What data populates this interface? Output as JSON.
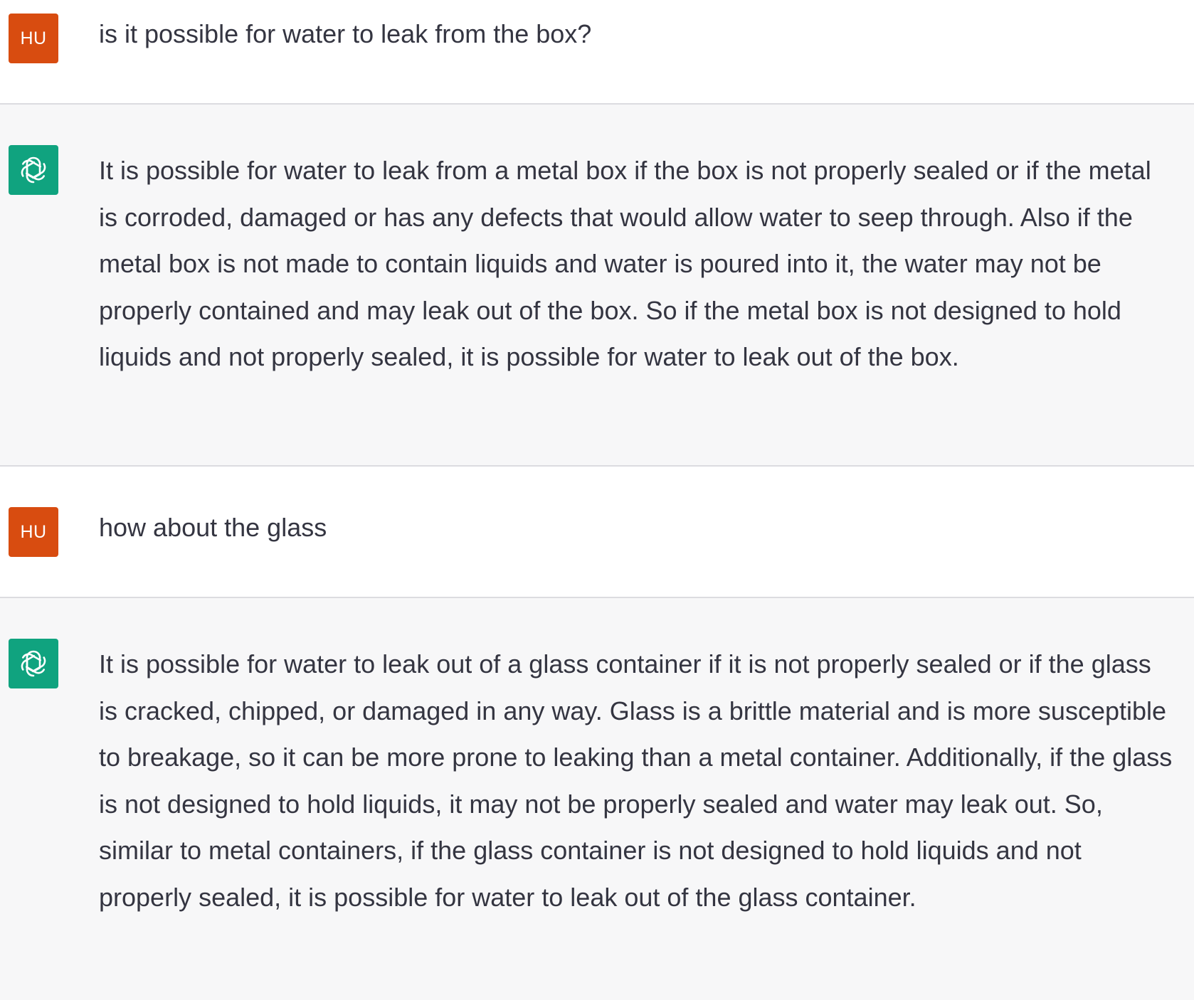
{
  "conversation": {
    "turns": [
      {
        "role": "user",
        "avatar_label": "HU",
        "text": "is it possible for water to leak from the box?"
      },
      {
        "role": "assistant",
        "avatar_icon": "openai-logo-icon",
        "text": "It is possible for water to leak from a metal box if the box is not properly sealed or if the metal is corroded, damaged or has any defects that would allow water to seep through. Also if the metal box is not made to contain liquids and water is poured into it, the water may not be properly contained and may leak out of the box. So if the metal box is not designed to hold liquids and not properly sealed, it is possible for water to leak out of the box."
      },
      {
        "role": "user",
        "avatar_label": "HU",
        "text": "how about the glass"
      },
      {
        "role": "assistant",
        "avatar_icon": "openai-logo-icon",
        "text": "It is possible for water to leak out of a glass container if it is not properly sealed or if the glass is cracked, chipped, or damaged in any way. Glass is a brittle material and is more susceptible to breakage, so it can be more prone to leaking than a metal container. Additionally, if the glass is not designed to hold liquids, it may not be properly sealed and water may leak out. So, similar to metal containers, if the glass container is not designed to hold liquids and not properly sealed, it is possible for water to leak out of the glass container."
      }
    ]
  },
  "colors": {
    "user_avatar_bg": "#d84c10",
    "assistant_avatar_bg": "#10a37f",
    "assistant_row_bg": "#f7f7f8",
    "text": "#343541"
  }
}
